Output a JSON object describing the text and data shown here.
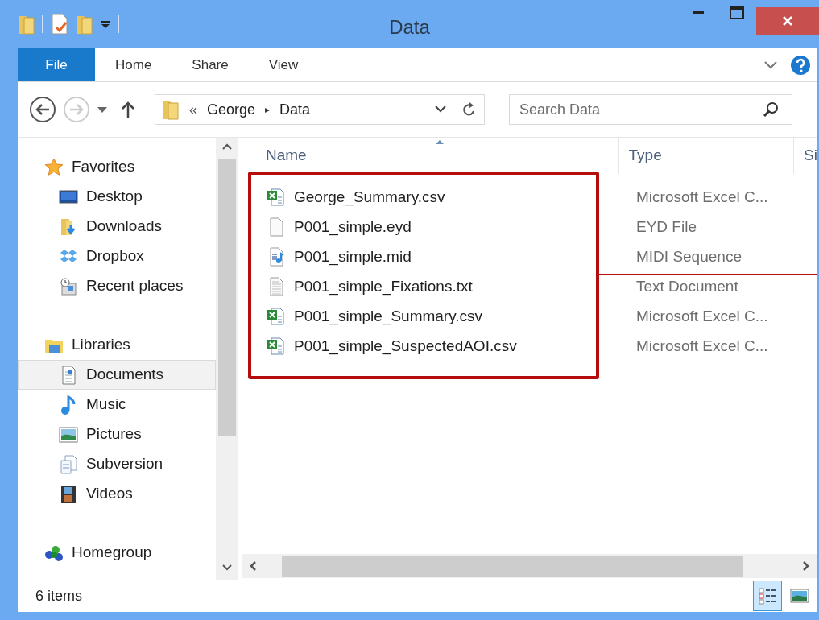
{
  "window": {
    "title": "Data"
  },
  "ribbon_tabs": [
    {
      "label": "File",
      "kind": "file",
      "selected": false
    },
    {
      "label": "Home",
      "kind": "tab",
      "selected": false
    },
    {
      "label": "Share",
      "kind": "tab",
      "selected": false
    },
    {
      "label": "View",
      "kind": "tab",
      "selected": false
    }
  ],
  "address": {
    "overflow": "«",
    "crumbs": [
      {
        "label": "George",
        "separator": "▸"
      },
      {
        "label": "Data"
      }
    ]
  },
  "search": {
    "placeholder": "Search Data"
  },
  "nav": [
    {
      "label": "Favorites",
      "kind": "star",
      "selected": false,
      "children": [
        {
          "label": "Desktop",
          "kind": "desktop",
          "selected": false
        },
        {
          "label": "Downloads",
          "kind": "downloads",
          "selected": false
        },
        {
          "label": "Dropbox",
          "kind": "dropbox",
          "selected": false
        },
        {
          "label": "Recent places",
          "kind": "recent",
          "selected": false
        }
      ]
    },
    {
      "label": "Libraries",
      "kind": "libraries",
      "selected": false,
      "children": [
        {
          "label": "Documents",
          "kind": "documents",
          "selected": true
        },
        {
          "label": "Music",
          "kind": "music",
          "selected": false
        },
        {
          "label": "Pictures",
          "kind": "pictures",
          "selected": false
        },
        {
          "label": "Subversion",
          "kind": "subversion",
          "selected": false
        },
        {
          "label": "Videos",
          "kind": "videos",
          "selected": false
        }
      ]
    },
    {
      "label": "Homegroup",
      "kind": "homegroup",
      "selected": false
    }
  ],
  "table": {
    "columns": [
      "Name",
      "Type",
      "Si"
    ],
    "rows": [
      {
        "name": "George_Summary.csv",
        "type": "Microsoft Excel C...",
        "kind": "excel"
      },
      {
        "name": "P001_simple.eyd",
        "type": "EYD File",
        "kind": "blank"
      },
      {
        "name": "P001_simple.mid",
        "type": "MIDI Sequence",
        "kind": "midi"
      },
      {
        "name": "P001_simple_Fixations.txt",
        "type": "Text Document",
        "kind": "text"
      },
      {
        "name": "P001_simple_Summary.csv",
        "type": "Microsoft Excel C...",
        "kind": "excel"
      },
      {
        "name": "P001_simple_SuspectedAOI.csv",
        "type": "Microsoft Excel C...",
        "kind": "excel"
      }
    ]
  },
  "status_bar": {
    "count": "6 items"
  },
  "view_buttons": [
    {
      "kind": "details",
      "selected": true
    },
    {
      "kind": "large_icons",
      "selected": false
    }
  ]
}
